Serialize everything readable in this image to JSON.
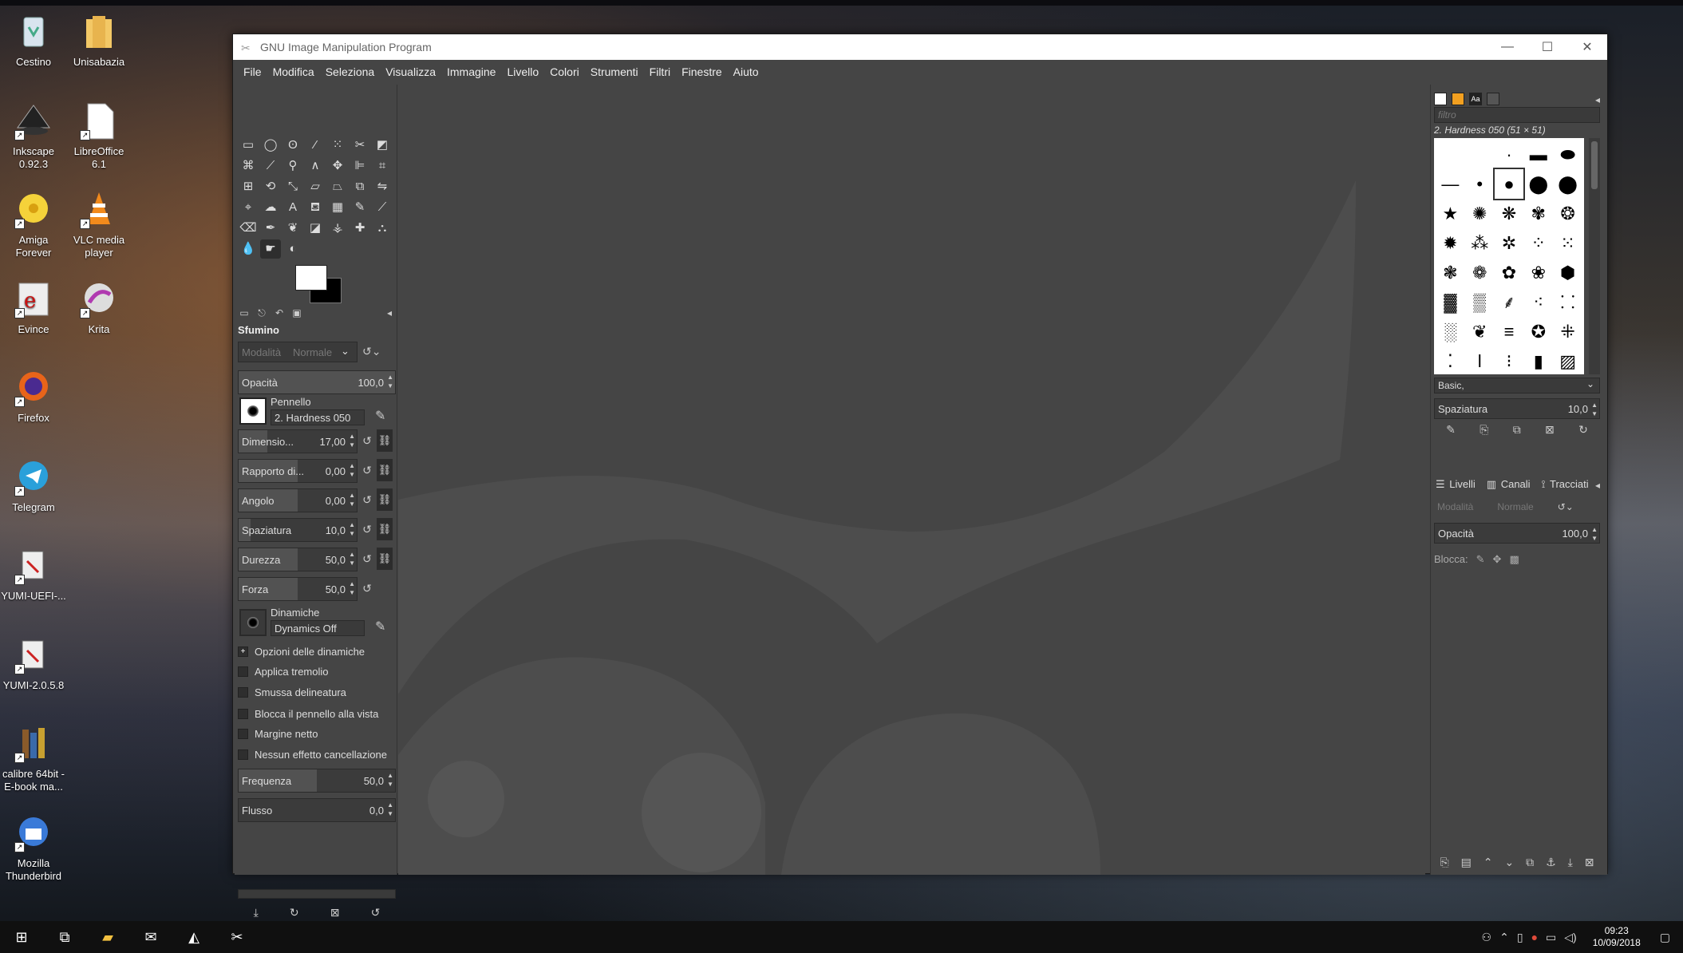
{
  "desktop": {
    "icons": [
      {
        "label": "Cestino"
      },
      {
        "label": "Unisabazia"
      },
      {
        "label": "Inkscape 0.92.3"
      },
      {
        "label": "LibreOffice 6.1"
      },
      {
        "label": "Amiga Forever"
      },
      {
        "label": "VLC media player"
      },
      {
        "label": "Evince"
      },
      {
        "label": "Krita"
      },
      {
        "label": "Firefox"
      },
      {
        "label": "Telegram"
      },
      {
        "label": "YUMI-UEFI-..."
      },
      {
        "label": "YUMI-2.0.5.8"
      },
      {
        "label": "calibre 64bit - E-book ma..."
      },
      {
        "label": "Mozilla Thunderbird"
      }
    ]
  },
  "window": {
    "title": "GNU Image Manipulation Program",
    "menu": [
      "File",
      "Modifica",
      "Seleziona",
      "Visualizza",
      "Immagine",
      "Livello",
      "Colori",
      "Strumenti",
      "Filtri",
      "Finestre",
      "Aiuto"
    ]
  },
  "tool_options": {
    "title": "Sfumino",
    "mode_label": "Modalità",
    "mode_value": "Normale",
    "opacity": {
      "label": "Opacità",
      "value": "100,0"
    },
    "brush": {
      "label": "Pennello",
      "value": "2. Hardness 050"
    },
    "rows": [
      {
        "label": "Dimensio...",
        "value": "17,00"
      },
      {
        "label": "Rapporto di...",
        "value": "0,00"
      },
      {
        "label": "Angolo",
        "value": "0,00"
      },
      {
        "label": "Spaziatura",
        "value": "10,0"
      },
      {
        "label": "Durezza",
        "value": "50,0"
      },
      {
        "label": "Forza",
        "value": "50,0"
      }
    ],
    "dynamics": {
      "label": "Dinamiche",
      "value": "Dynamics Off"
    },
    "checks": [
      {
        "label": "Opzioni delle dinamiche",
        "checked": true
      },
      {
        "label": "Applica tremolio",
        "checked": false
      },
      {
        "label": "Smussa delineatura",
        "checked": false
      },
      {
        "label": "Blocca il pennello alla vista",
        "checked": false
      },
      {
        "label": "Margine netto",
        "checked": false
      },
      {
        "label": "Nessun effetto cancellazione",
        "checked": false
      }
    ],
    "frequency": {
      "label": "Frequenza",
      "value": "50,0"
    },
    "flow": {
      "label": "Flusso",
      "value": "0,0"
    }
  },
  "brushes": {
    "filter_placeholder": "filtro",
    "current": "2. Hardness 050 (51 × 51)",
    "preset": "Basic,",
    "spacing": {
      "label": "Spaziatura",
      "value": "10,0"
    }
  },
  "layers": {
    "tabs": [
      "Livelli",
      "Canali",
      "Tracciati"
    ],
    "mode_label": "Modalità",
    "mode_value": "Normale",
    "opacity": {
      "label": "Opacità",
      "value": "100,0"
    },
    "lock_label": "Blocca:"
  },
  "taskbar": {
    "time": "09:23",
    "date": "10/09/2018"
  }
}
